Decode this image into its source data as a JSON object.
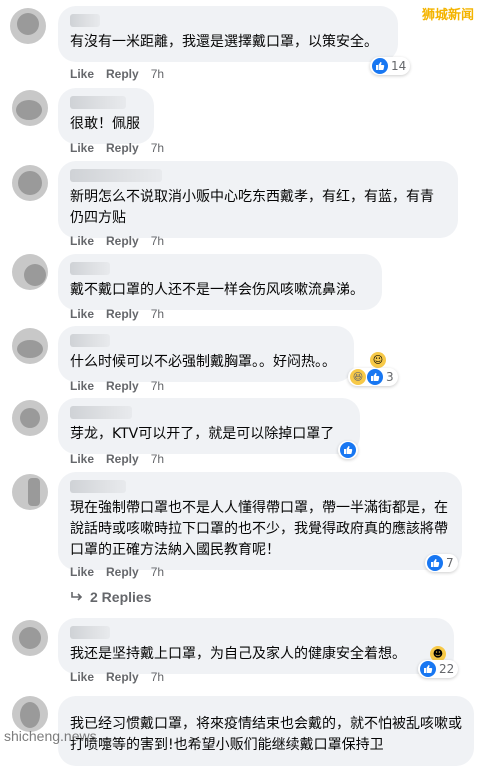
{
  "watermark": {
    "top": "狮城新闻",
    "bottom": "shicheng.news"
  },
  "labels": {
    "like": "Like",
    "reply": "Reply"
  },
  "comments": [
    {
      "text": "有沒有一米距離，我還是選擇戴口罩，以策安全。",
      "time": "7h",
      "reactions": "14"
    },
    {
      "text": "很敢！佩服",
      "time": "7h",
      "reactions": ""
    },
    {
      "text": "新明怎么不说取消小贩中心吃东西戴孝，有红，有蓝，有青仍四方贴",
      "time": "7h",
      "reactions": ""
    },
    {
      "text": "戴不戴口罩的人还不是一样会伤风咳嗽流鼻涕。",
      "time": "7h",
      "reactions": ""
    },
    {
      "text": "什么时候可以不必强制戴胸罩。。好闷热。。",
      "time": "7h",
      "reactions": "3"
    },
    {
      "text": "芽龙，KTV可以开了，就是可以除掉口罩了",
      "time": "7h",
      "reactions": ""
    },
    {
      "text": "現在強制帶口罩也不是人人懂得帶口罩，帶一半滿街都是，在說話時或咳嗽時拉下口罩的也不少，我覺得政府真的應該將帶口罩的正確方法納入國民教育呢！",
      "time": "7h",
      "reactions": "7"
    },
    {
      "text": "我还是坚持戴上口罩，为自己及家人的健康安全着想。",
      "time": "7h",
      "reactions": "22"
    },
    {
      "text": "我已经习惯戴口罩，将來疫情结束也会戴的，就不怕被乱咳嗽或打喷嚏等的害到!也希望小贩们能继续戴口罩保持卫",
      "time": "",
      "reactions": ""
    }
  ],
  "replies_link": "2 Replies",
  "colors": {
    "like_blue": "#1877f2",
    "bubble_bg": "#f0f2f5",
    "meta_gray": "#65676b"
  },
  "icons": {
    "like": "thumbs-up-icon",
    "haha": "laughing-emoji-icon",
    "smile": "slightly-smiling-emoji-icon",
    "replies": "reply-arrow-icon"
  }
}
